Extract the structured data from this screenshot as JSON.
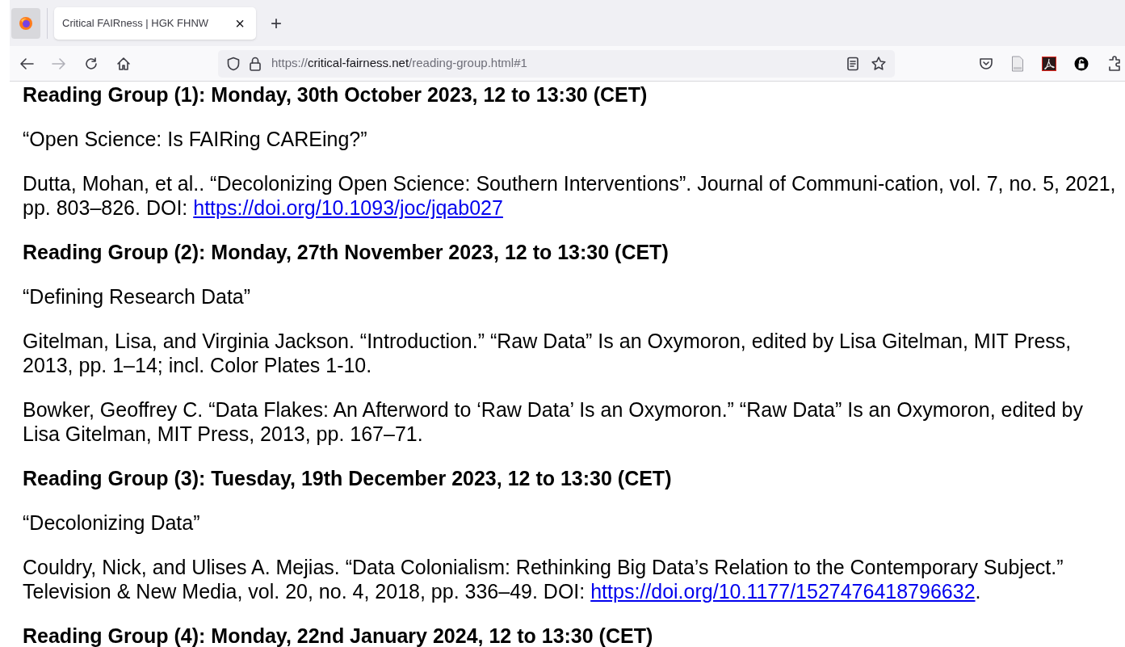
{
  "tabs": [
    {
      "title": "Critical FAIRness | HGK FHNW",
      "selected": true,
      "close": "×"
    }
  ],
  "new_tab": "+",
  "url": {
    "scheme": "https://",
    "host": "critical-fairness.net",
    "path": "/reading-group.html#1"
  },
  "content": [
    {
      "kind": "heading",
      "text": "Reading Group (1): Monday, 30th October 2023, 12 to 13:30 (CET)"
    },
    {
      "kind": "title",
      "text": "“Open Science: Is FAIRing CAREing?”"
    },
    {
      "kind": "citation",
      "text": "Dutta, Mohan, et al.. “Decolonizing Open Science: Southern Interventions”. Journal of Communi-cation, vol. 7, no. 5, 2021, pp. 803–826. DOI:",
      "link": "https://doi.org/10.1093/joc/jqab027"
    },
    {
      "kind": "heading",
      "text": "Reading Group (2): Monday, 27th November 2023, 12 to 13:30 (CET)"
    },
    {
      "kind": "title",
      "text": "“Defining Research Data”"
    },
    {
      "kind": "citation",
      "text": "Gitelman, Lisa, and Virginia Jackson. “Introduction.” “Raw Data” Is an Oxymoron, edited by Lisa Gitelman, MIT Press, 2013, pp. 1–14; incl. Color Plates 1-10."
    },
    {
      "kind": "citation",
      "text": "Bowker, Geoffrey C. “Data Flakes: An Afterword to ‘Raw Data’ Is an Oxymoron.” “Raw Data” Is an Oxymoron, edited by Lisa Gitelman, MIT Press, 2013, pp. 167–71."
    },
    {
      "kind": "heading",
      "text": "Reading Group (3): Tuesday, 19th December 2023, 12 to 13:30 (CET)"
    },
    {
      "kind": "title",
      "text": "“Decolonizing Data”"
    },
    {
      "kind": "citation",
      "text": "Couldry, Nick, and Ulises A. Mejias. “Data Colonialism: Rethinking Big Data’s Relation to the Contemporary Subject.” Television & New Media, vol. 20, no. 4, 2018, pp. 336–49. DOI:",
      "link": "https://doi.org/10.1177/1527476418796632",
      "after": "."
    },
    {
      "kind": "heading",
      "text": "Reading Group (4): Monday, 22nd January 2024, 12 to 13:30 (CET)"
    }
  ]
}
